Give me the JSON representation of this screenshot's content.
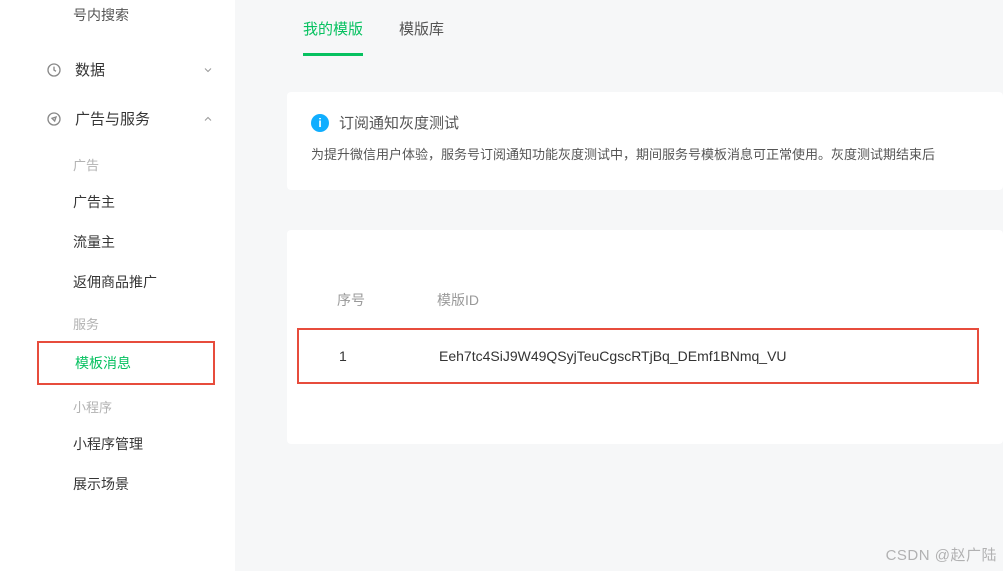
{
  "sidebar": {
    "top_item": "号内搜索",
    "sections": [
      {
        "label": "数据",
        "expanded": false
      },
      {
        "label": "广告与服务",
        "expanded": true
      }
    ],
    "group_ad": {
      "label": "广告",
      "items": [
        "广告主",
        "流量主",
        "返佣商品推广"
      ]
    },
    "group_service": {
      "label": "服务",
      "items": [
        "模板消息"
      ]
    },
    "group_mini": {
      "label": "小程序",
      "items": [
        "小程序管理",
        "展示场景"
      ]
    }
  },
  "tabs": {
    "my_templates": "我的模版",
    "template_lib": "模版库"
  },
  "notice": {
    "title": "订阅通知灰度测试",
    "desc": "为提升微信用户体验，服务号订阅通知功能灰度测试中，期间服务号模板消息可正常使用。灰度测试期结束后"
  },
  "table": {
    "headers": {
      "seq": "序号",
      "id": "模版ID"
    },
    "rows": [
      {
        "seq": "1",
        "id": "Eeh7tc4SiJ9W49QSyjTeuCgscRTjBq_DEmf1BNmq_VU"
      }
    ]
  },
  "watermark": "CSDN @赵广陆"
}
